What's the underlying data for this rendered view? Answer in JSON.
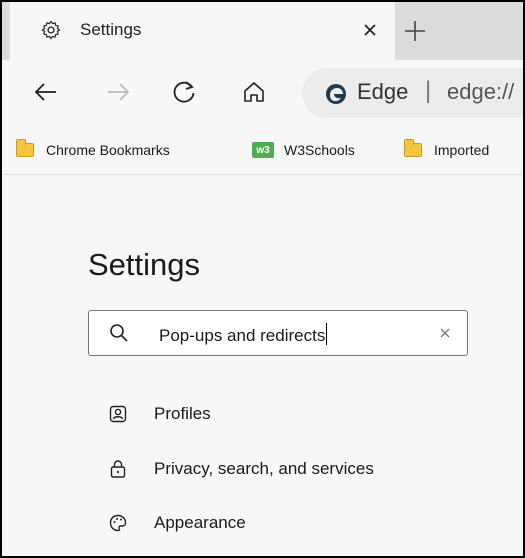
{
  "tab": {
    "title": "Settings"
  },
  "toolbar": {
    "site_name": "Edge",
    "separator": "|",
    "url": "edge://"
  },
  "bookmarks": [
    {
      "label": "Chrome Bookmarks",
      "icon": "folder-icon"
    },
    {
      "label": "W3Schools",
      "icon": "w3schools-icon"
    },
    {
      "label": "Imported",
      "icon": "folder-icon"
    }
  ],
  "page": {
    "title": "Settings",
    "search_value": "Pop-ups and redirects"
  },
  "nav": [
    {
      "label": "Profiles",
      "icon": "profile-icon"
    },
    {
      "label": "Privacy, search, and services",
      "icon": "lock-icon"
    },
    {
      "label": "Appearance",
      "icon": "palette-icon"
    }
  ],
  "colors": {
    "tabstrip": "#dcdcdc",
    "background": "#f7f7f7",
    "w3schools": "#4caf50",
    "folder": "#f5c542"
  }
}
